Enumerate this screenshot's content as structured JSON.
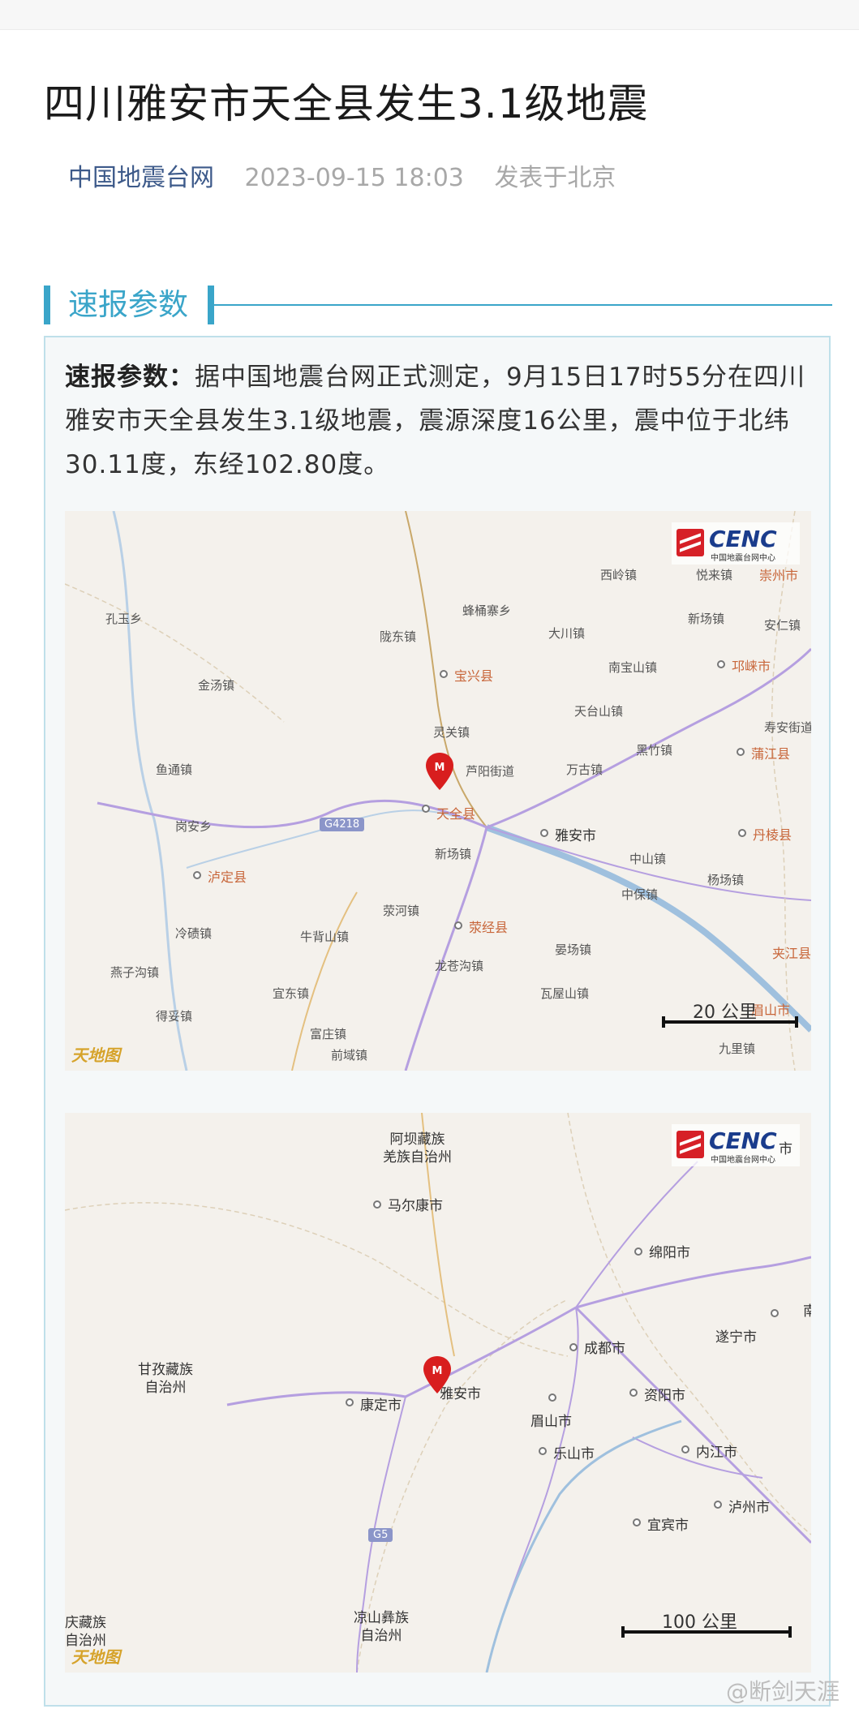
{
  "article": {
    "title": "四川雅安市天全县发生3.1级地震",
    "source": "中国地震台网",
    "time": "2023-09-15 18:03",
    "location": "发表于北京"
  },
  "section": {
    "heading": "速报参数",
    "label": "速报参数：",
    "body": "据中国地震台网正式测定，9月15日17时55分在四川雅安市天全县发生3.1级地震，震源深度16公里，震中位于北纬30.11度，东经102.80度。"
  },
  "map1": {
    "logo": "CENC",
    "logo_sub": "中国地震台网中心",
    "basemap_logo": "天地图",
    "scale": "20 公里",
    "road": "G4218",
    "places": {
      "kongyu": "孔玉乡",
      "jintang": "金汤镇",
      "yutong": "鱼通镇",
      "gangan": "岗安乡",
      "luding": "泸定县",
      "lengqi": "冷碛镇",
      "yanzigou": "燕子沟镇",
      "detuo": "得妥镇",
      "longdong": "陇东镇",
      "fengtongzhai": "蜂桶寨乡",
      "baoxing": "宝兴县",
      "lingguan": "灵关镇",
      "luyang": "芦阳街道",
      "tianquan": "天全县",
      "xinchang": "新场镇",
      "niubeishan": "牛背山镇",
      "yidong": "宜东镇",
      "fuzhuang": "富庄镇",
      "qianyu": "前域镇",
      "yinghe": "荥河镇",
      "yingjing": "荥经县",
      "longcanggou": "龙苍沟镇",
      "xiling": "西岭镇",
      "dachuan": "大川镇",
      "nanbaoshan": "南宝山镇",
      "tiantaishan": "天台山镇",
      "wangu": "万古镇",
      "heizhu": "黑竹镇",
      "yaan": "雅安市",
      "zhongshan": "中山镇",
      "zhongbao": "中保镇",
      "yanchang": "晏场镇",
      "washan": "瓦屋山镇",
      "yuegong": "悦来镇",
      "chongzhou": "崇州市",
      "xinchang2": "新场镇",
      "anren": "安仁镇",
      "qionglai": "邛崃市",
      "shouan": "寿安街道",
      "pujiang": "蒲江县",
      "danleng": "丹棱县",
      "yangchang": "杨场镇",
      "jiajiang": "夹江县",
      "emeishan": "眉山市",
      "jiuli": "九里镇"
    }
  },
  "map2": {
    "logo": "CENC",
    "logo_sub": "中国地震台网中心",
    "basemap_logo": "天地图",
    "scale": "100 公里",
    "road": "G5",
    "places": {
      "aba": "阿坝藏族\n羌族自治州",
      "maerkang": "马尔康市",
      "ganzi": "甘孜藏族\n自治州",
      "kangding": "康定市",
      "yaan": "雅安市",
      "chengdu": "成都市",
      "mianyang": "绵阳市",
      "suining": "遂宁市",
      "meishan": "眉山市",
      "ziyang": "资阳市",
      "leshan": "乐山市",
      "neijiang": "内江市",
      "yibin": "宜宾市",
      "luzhou": "泸州市",
      "liangshan": "凉山彝族\n自治州",
      "qingzang": "庆藏族\n自治州",
      "nan": "南",
      "shi": "市"
    }
  },
  "watermark": "@断剑天涯"
}
